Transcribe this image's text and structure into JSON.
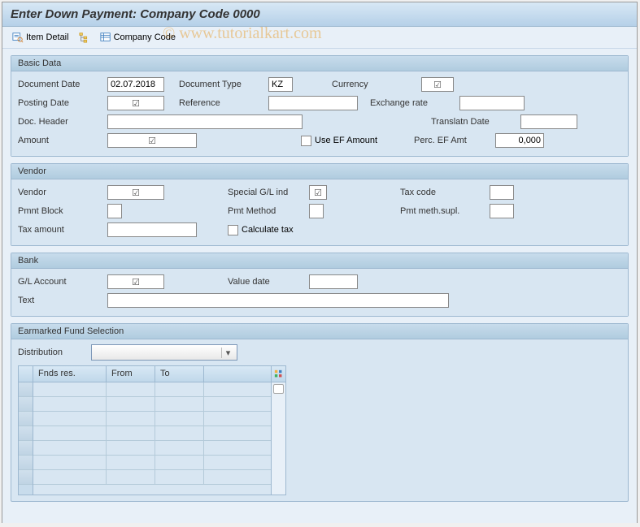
{
  "title": "Enter Down Payment: Company Code 0000",
  "watermark": "©   www.tutorialkart.com",
  "toolbar": {
    "item_detail": "Item Detail",
    "company_code": "Company Code"
  },
  "groups": {
    "basic_data": {
      "title": "Basic Data",
      "fields": {
        "document_date": {
          "label": "Document Date",
          "value": "02.07.2018"
        },
        "document_type": {
          "label": "Document Type",
          "value": "KZ"
        },
        "currency": {
          "label": "Currency",
          "value": ""
        },
        "posting_date": {
          "label": "Posting Date",
          "value": ""
        },
        "reference": {
          "label": "Reference",
          "value": ""
        },
        "exchange_rate": {
          "label": "Exchange rate",
          "value": ""
        },
        "doc_header": {
          "label": "Doc. Header",
          "value": ""
        },
        "translatn_date": {
          "label": "Translatn Date",
          "value": ""
        },
        "amount": {
          "label": "Amount",
          "value": ""
        },
        "use_ef_amount": {
          "label": "Use EF Amount"
        },
        "perc_ef_amt": {
          "label": "Perc. EF Amt",
          "value": "0,000"
        }
      }
    },
    "vendor": {
      "title": "Vendor",
      "fields": {
        "vendor": {
          "label": "Vendor",
          "value": ""
        },
        "special_gl_ind": {
          "label": "Special G/L ind",
          "value": ""
        },
        "tax_code": {
          "label": "Tax code",
          "value": ""
        },
        "pmnt_block": {
          "label": "Pmnt Block",
          "value": ""
        },
        "pmt_method": {
          "label": "Pmt Method",
          "value": ""
        },
        "pmt_meth_supl": {
          "label": "Pmt meth.supl.",
          "value": ""
        },
        "tax_amount": {
          "label": "Tax amount",
          "value": ""
        },
        "calculate_tax": {
          "label": "Calculate tax"
        }
      }
    },
    "bank": {
      "title": "Bank",
      "fields": {
        "gl_account": {
          "label": "G/L Account",
          "value": ""
        },
        "value_date": {
          "label": "Value date",
          "value": ""
        },
        "text": {
          "label": "Text",
          "value": ""
        }
      }
    },
    "earmarked": {
      "title": "Earmarked Fund Selection",
      "distribution_label": "Distribution",
      "distribution_value": "",
      "columns": {
        "fnds_res": "Fnds res.",
        "from": "From",
        "to": "To"
      }
    }
  }
}
